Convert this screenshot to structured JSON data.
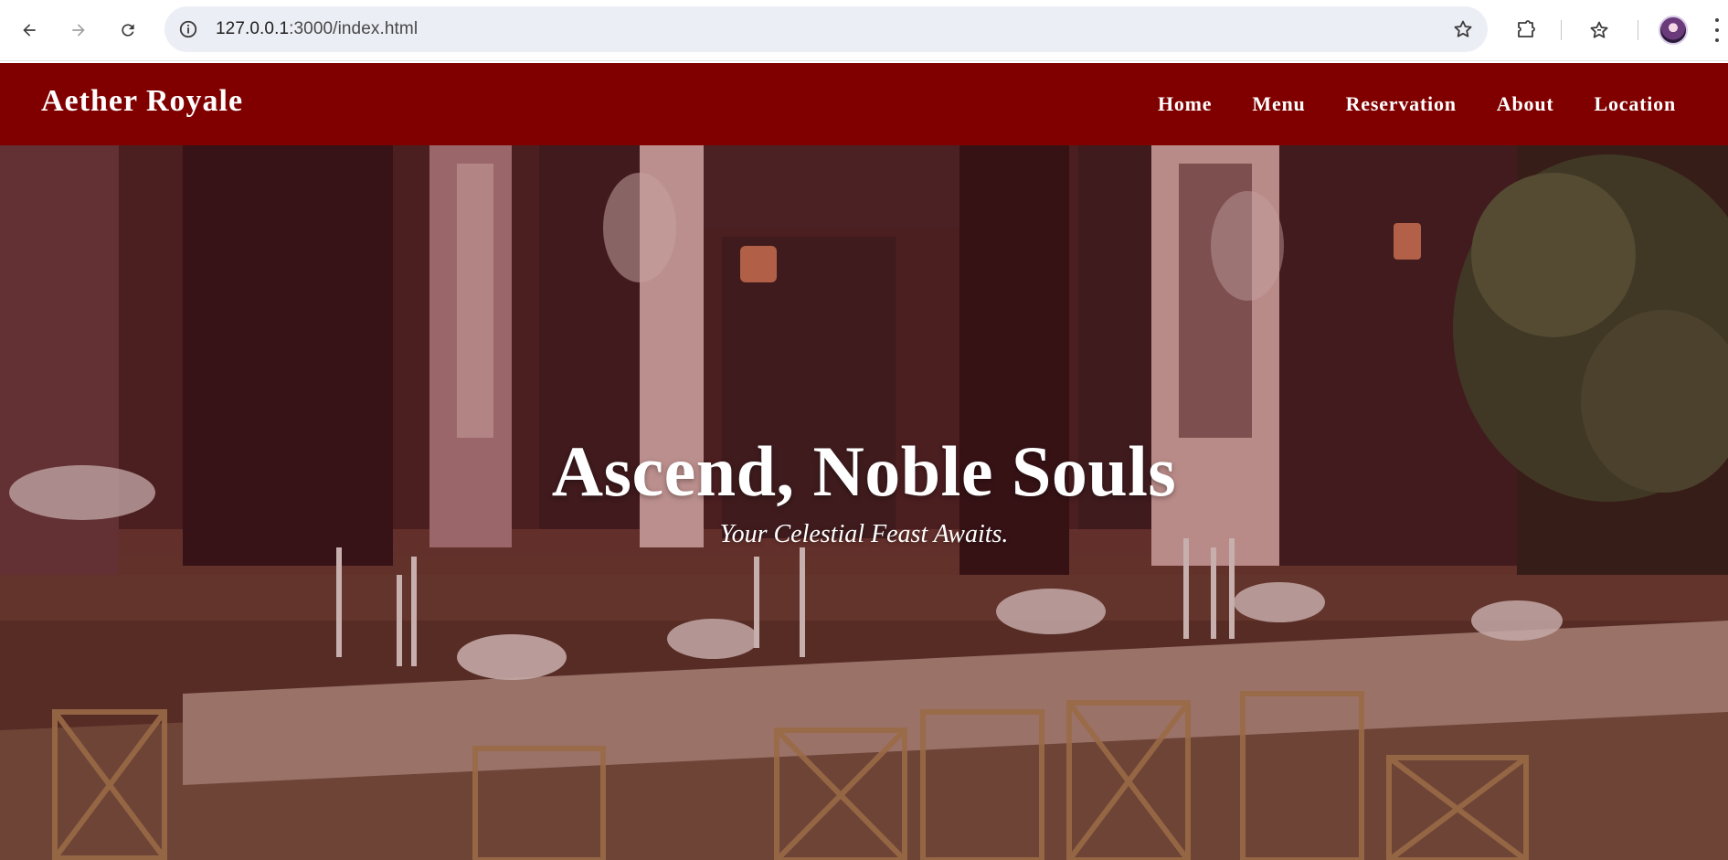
{
  "browser": {
    "url_host": "127.0.0.1",
    "url_path": ":3000/index.html",
    "icons": {
      "back": "arrow-left-icon",
      "forward": "arrow-right-icon",
      "reload": "reload-icon",
      "site_info": "info-icon",
      "bookmark": "star-outline-icon",
      "extensions": "puzzle-icon",
      "bookmarks_manager": "star-list-icon",
      "profile": "avatar-icon",
      "menu": "kebab-menu-icon"
    }
  },
  "site": {
    "brand": "Aether Royale",
    "nav": [
      {
        "label": "Home"
      },
      {
        "label": "Menu"
      },
      {
        "label": "Reservation"
      },
      {
        "label": "About"
      },
      {
        "label": "Location"
      }
    ],
    "colors": {
      "header_bg": "#800000",
      "header_text": "#ffffff"
    }
  },
  "hero": {
    "title": "Ascend, Noble Souls",
    "subtitle": "Your Celestial Feast Awaits."
  }
}
